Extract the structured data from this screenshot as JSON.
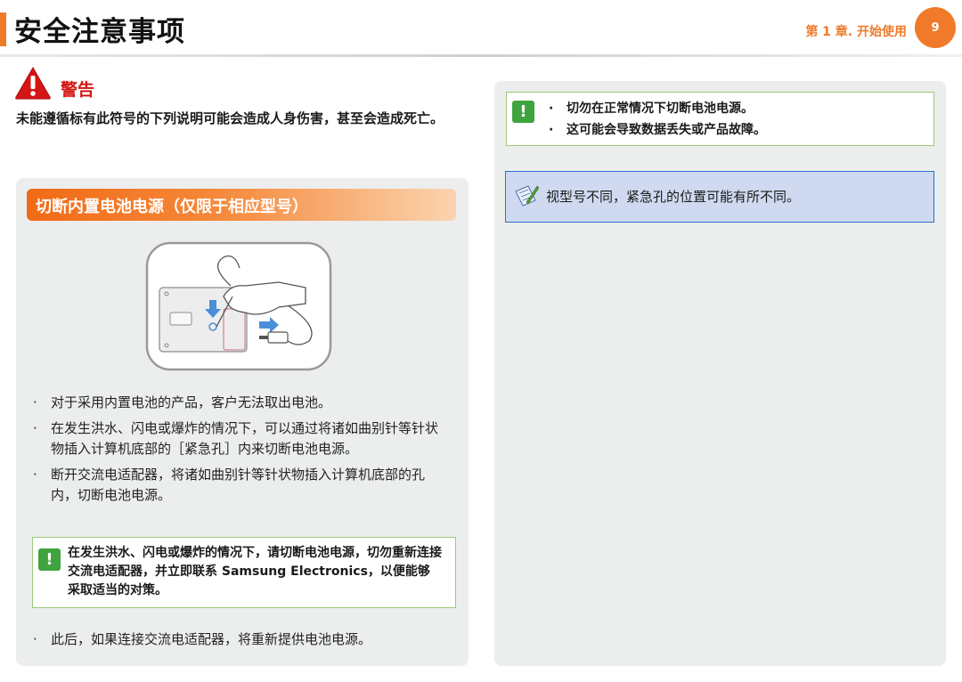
{
  "header": {
    "title": "安全注意事项",
    "chapter": "第 1 章. 开始使用",
    "page_number": "9",
    "accent_color": "#f07a2a"
  },
  "warning": {
    "icon": "warning-triangle-icon",
    "title": "警告",
    "description": "未能遵循标有此符号的下列说明可能会造成人身伤害，甚至会造成死亡。",
    "title_color": "#d41515"
  },
  "section": {
    "title": "切断内置电池电源（仅限于相应型号）",
    "bullet_symbol": "·",
    "bullets": [
      "对于采用内置电池的产品，客户无法取出电池。",
      "在发生洪水、闪电或爆炸的情况下，可以通过将诸如曲别针等针状物插入计算机底部的［紧急孔］内来切断电池电源。",
      "断开交流电适配器，将诸如曲别针等针状物插入计算机底部的孔内，切断电池电源。"
    ],
    "caution_note": "在发生洪水、闪电或爆炸的情况下，请切断电池电源，切勿重新连接交流电适配器，并立即联系 Samsung Electronics，以便能够采取适当的对策。",
    "last_bullet": "此后，如果连接交流电适配器，将重新提供电池电源。",
    "illustration_icon": "laptop-emergency-hole-illustration"
  },
  "right": {
    "caution_items": [
      "切勿在正常情况下切断电池电源。",
      "这可能会导致数据丢失或产品故障。"
    ],
    "info_note": "视型号不同，紧急孔的位置可能有所不同。",
    "caution_icon": "caution-exclamation-icon",
    "info_icon": "memo-pencil-icon",
    "caution_color": "#3fa43f",
    "info_border_color": "#2a6ed0"
  },
  "caution_symbol": "!"
}
